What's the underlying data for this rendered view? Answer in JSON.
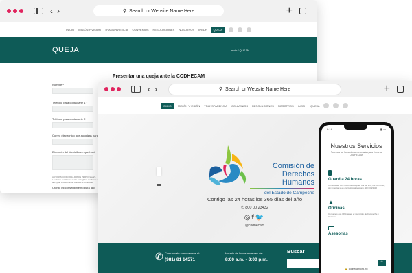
{
  "back_window": {
    "url_text": "Search or Website Name Here",
    "nav_items": [
      "INICIO",
      "MISIÓN Y VISIÓN",
      "TRANSPARENCIA",
      "CONVENIOS",
      "RESOLUCIONES",
      "NOSOTROS",
      "INEDH",
      "QUEJA"
    ],
    "active_nav": "QUEJA",
    "page_title": "QUEJA",
    "breadcrumb": "Inicio / QUEJA",
    "form_title": "Presentar una queja ante la CODHECAM",
    "fields": [
      "Nombre *",
      "Teléfono para contactarte 1 *",
      "Teléfono para contactarte 2",
      "Correo electrónico que autorizas para",
      "Dirección del domicilio en que habit"
    ],
    "legal_text": "AUTORIZACIÓN PARA DATOS PERSONALES. Los datos recabados serán protegidos conforme a la Ley de Protección de Datos Personales en Posesión de Sujetos Obligados del Estado de Campeche.",
    "consent_text": "Otorgo mi consentimiento para la c"
  },
  "front_window": {
    "url_text": "Search or Website Name Here",
    "nav_items": [
      "INICIO",
      "MISIÓN Y VISIÓN",
      "TRANSPARENCIA",
      "CONVENIOS",
      "RESOLUCIONES",
      "NOSOTROS",
      "INEDH",
      "QUEJA"
    ],
    "active_nav": "INICIO",
    "logo_line1": "Comisión de",
    "logo_line2": "Derechos Humanos",
    "logo_line3": "del Estado de Campeche",
    "tagline": "Contigo las 24 horas los 365 días del año",
    "phone": "800 00 23432",
    "social_handle": "@codhecam",
    "footer_contact_label": "Comunícate con nosotros al:",
    "footer_phone": "(981) 81 14571",
    "footer_hours_label": "Horario de Lunes a viernes de:",
    "footer_hours": "8:00 a.m. - 3:00 p.m.",
    "footer_search": "Buscar"
  },
  "phone": {
    "time": "9:14",
    "title": "Nuestros Servicios",
    "subtitle": "Tenemos las herramientas necesarias para ti ante la CODHECAM.",
    "services": [
      {
        "title": "Guardia 24 horas",
        "text": "Comunícate con nosotros cualquier día del año, las 24 horas, sin importar si es día festivo al teléfono 800 00 23432"
      },
      {
        "title": "Oficinas",
        "text": "Contamos con Oficinas en el municipio de Campeche y Carmen"
      },
      {
        "title": "Asesorías",
        "text": ""
      }
    ],
    "url": "codhecam.org.mx"
  },
  "colors": {
    "teal": "#0e5b57",
    "accent_red": "#e0245e",
    "logo_blue": "#2a8ac4",
    "logo_green": "#8dc63f"
  }
}
